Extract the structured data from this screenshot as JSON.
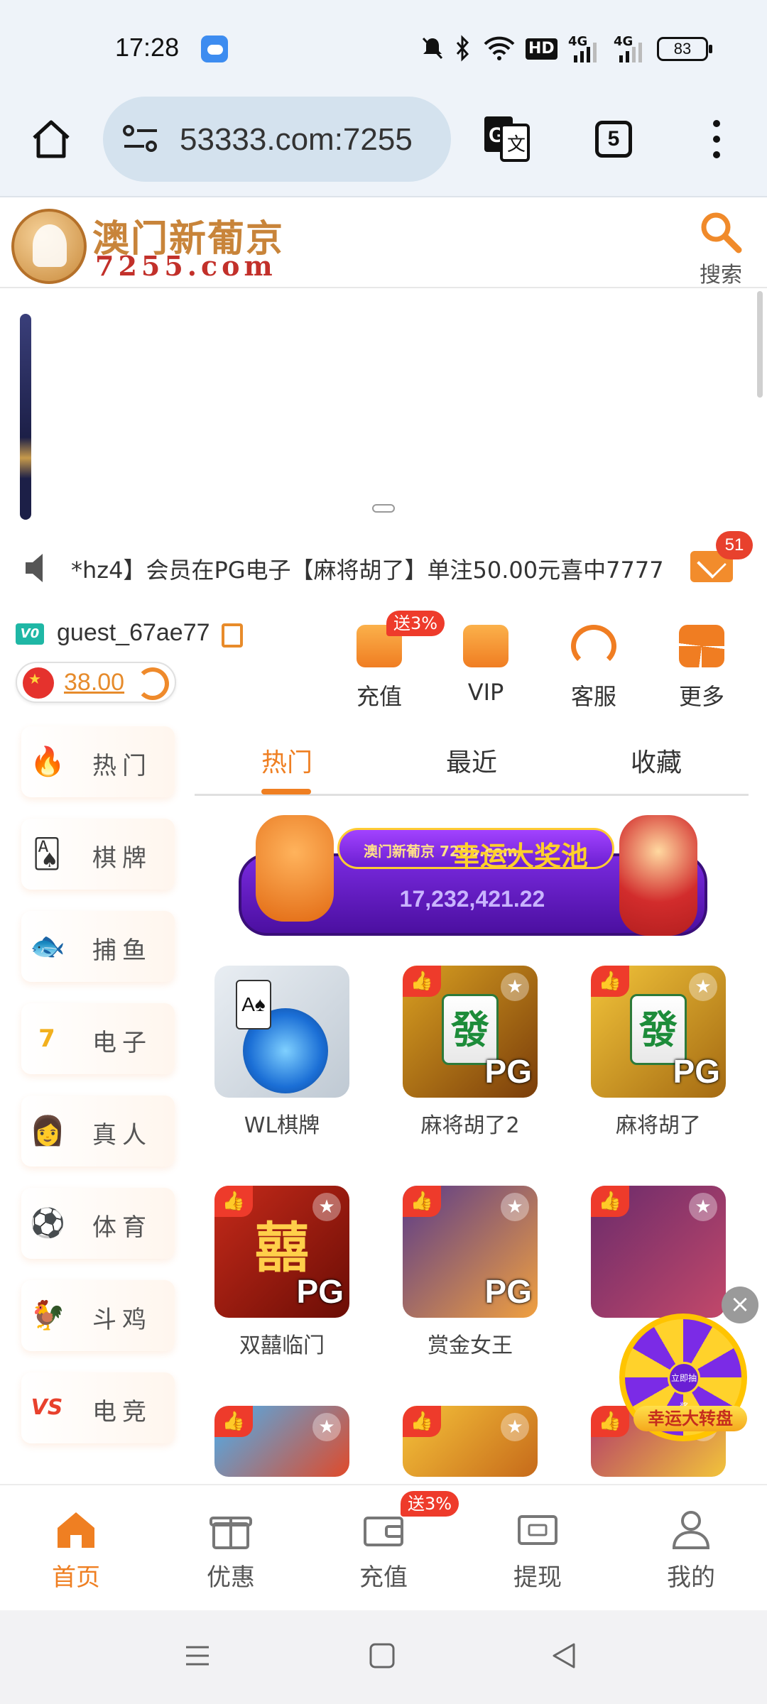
{
  "status": {
    "time": "17:28",
    "network_hd": "HD",
    "network_a": "4G",
    "network_b": "4G",
    "battery": "83"
  },
  "browser": {
    "url": "53333.com:7255",
    "tab_count": "5"
  },
  "site": {
    "logo_cn": "澳门新葡京",
    "logo_en": "7255.com",
    "search_label": "搜索"
  },
  "marquee": {
    "text": "*hz4】会员在PG电子【麻将胡了】单注50.00元喜中7777",
    "mail_count": "51"
  },
  "user": {
    "level": "V0",
    "name": "guest_67ae77",
    "balance": "38.00"
  },
  "quick_actions": [
    {
      "label": "充值",
      "tag": "送3%"
    },
    {
      "label": "VIP"
    },
    {
      "label": "客服"
    },
    {
      "label": "更多"
    }
  ],
  "left_nav": [
    {
      "label": "热门",
      "icon": "flame-icon",
      "glyph": "🔥"
    },
    {
      "label": "棋牌",
      "icon": "cards-icon",
      "glyph": "🂡"
    },
    {
      "label": "捕鱼",
      "icon": "fish-icon",
      "glyph": "🐟"
    },
    {
      "label": "电子",
      "icon": "slot-777-icon",
      "glyph": "7"
    },
    {
      "label": "真人",
      "icon": "dealer-icon",
      "glyph": "👩"
    },
    {
      "label": "体育",
      "icon": "soccer-ball-icon",
      "glyph": "⚽"
    },
    {
      "label": "斗鸡",
      "icon": "rooster-icon",
      "glyph": "🐓"
    },
    {
      "label": "电竞",
      "icon": "vs-icon",
      "glyph": "VS"
    }
  ],
  "tabs": [
    {
      "label": "热门",
      "active": true
    },
    {
      "label": "最近",
      "active": false
    },
    {
      "label": "收藏",
      "active": false
    }
  ],
  "jackpot": {
    "brand": "澳门新葡京 7255.com",
    "name": "幸运大奖池",
    "amount": "17,232,421.22"
  },
  "games": [
    {
      "name": "WL棋牌",
      "pg": "",
      "tile": ""
    },
    {
      "name": "麻将胡了2",
      "pg": "PG",
      "tile": "發"
    },
    {
      "name": "麻将胡了",
      "pg": "PG",
      "tile": "發"
    },
    {
      "name": "双囍临门",
      "pg": "PG",
      "tile": "囍"
    },
    {
      "name": "赏金女王",
      "pg": "PG",
      "tile": ""
    },
    {
      "name": "",
      "pg": "",
      "tile": ""
    },
    {
      "name": "",
      "pg": "",
      "tile": ""
    },
    {
      "name": "",
      "pg": "",
      "tile": ""
    },
    {
      "name": "",
      "pg": "",
      "tile": ""
    }
  ],
  "wheel": {
    "label": "幸运大转盘",
    "center": "立即抽奖"
  },
  "bottom_nav": [
    {
      "label": "首页",
      "active": true
    },
    {
      "label": "优惠",
      "active": false
    },
    {
      "label": "充值",
      "active": false,
      "tag": "送3%"
    },
    {
      "label": "提现",
      "active": false
    },
    {
      "label": "我的",
      "active": false
    }
  ],
  "colors": {
    "accent": "#ef7f22",
    "badge_red": "#ee3b2b",
    "jackpot_purple": "#6b1fd1"
  }
}
